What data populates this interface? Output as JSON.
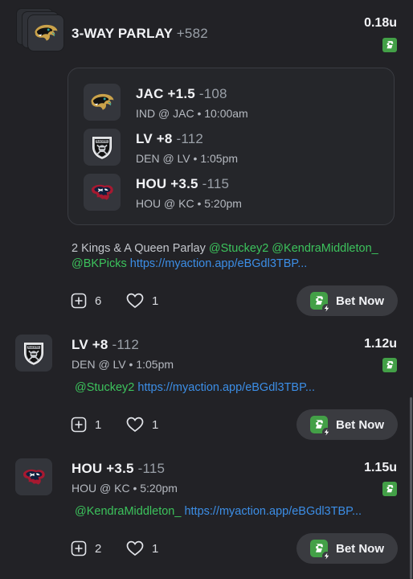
{
  "posts": [
    {
      "title_pick": "3-WAY PARLAY",
      "title_odds": "+582",
      "units": "0.18u",
      "logo": "jaguars-logo",
      "legs": [
        {
          "pick": "JAC +1.5",
          "odds": "-108",
          "matchup": "IND @ JAC • 10:00am",
          "logo": "jaguars-logo"
        },
        {
          "pick": "LV +8",
          "odds": "-112",
          "matchup": "DEN @ LV • 1:05pm",
          "logo": "raiders-logo"
        },
        {
          "pick": "HOU +3.5",
          "odds": "-115",
          "matchup": "HOU @ KC • 5:20pm",
          "logo": "texans-logo"
        }
      ],
      "caption_text": "2 Kings & A Queen Parlay ",
      "mention_1": "@Stuckey2",
      "mention_2": "@KendraMiddleton_",
      "mention_3": "@BKPicks",
      "link": "https://myaction.app/eBGdl3TBP...",
      "comments": "6",
      "likes": "1",
      "bet_label": "Bet Now"
    },
    {
      "title_pick": "LV +8",
      "title_odds": "-112",
      "matchup": "DEN @ LV • 1:05pm",
      "units": "1.12u",
      "logo": "raiders-logo",
      "mention": "@Stuckey2",
      "link": "https://myaction.app/eBGdl3TBP...",
      "comments": "1",
      "likes": "1",
      "bet_label": "Bet Now"
    },
    {
      "title_pick": "HOU +3.5",
      "title_odds": "-115",
      "matchup": "HOU @ KC • 5:20pm",
      "units": "1.15u",
      "logo": "texans-logo",
      "mention": "@KendraMiddleton_",
      "link": "https://myaction.app/eBGdl3TBP...",
      "comments": "2",
      "likes": "1",
      "bet_label": "Bet Now"
    }
  ],
  "colors": {
    "background": "#222226",
    "mention": "#3cc35c",
    "link": "#3c8ee6",
    "book_badge": "#43a047"
  }
}
